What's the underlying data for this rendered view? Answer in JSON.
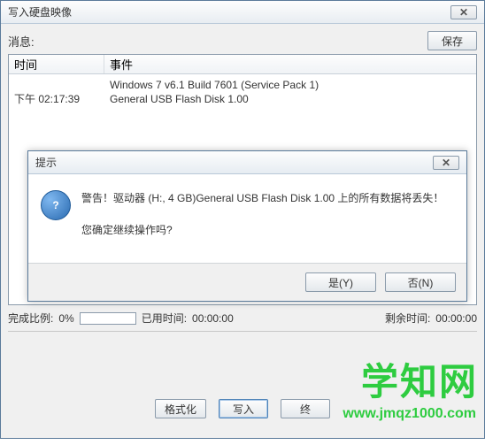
{
  "main": {
    "title": "写入硬盘映像",
    "close_glyph": "✕",
    "msg_label": "消息:",
    "save_label": "保存",
    "col_time": "时间",
    "col_event": "事件",
    "rows": [
      {
        "time": "",
        "event": "Windows 7 v6.1 Build 7601 (Service Pack 1)"
      },
      {
        "time": "下午 02:17:39",
        "event": "General USB Flash Disk  1.00"
      }
    ],
    "progress": {
      "done_label": "完成比例:",
      "done_value": "0%",
      "elapsed_label": "已用时间:",
      "elapsed_value": "00:00:00",
      "remain_label": "剩余时间:",
      "remain_value": "00:00:00"
    },
    "buttons": {
      "format": "格式化",
      "write": "写入",
      "abort": "终"
    }
  },
  "dialog": {
    "title": "提示",
    "close_glyph": "✕",
    "icon_glyph": "?",
    "warning": "警告！驱动器 (H:, 4 GB)General USB Flash Disk  1.00 上的所有数据将丢失！",
    "confirm": "您确定继续操作吗?",
    "yes": "是(Y)",
    "no": "否(N)"
  },
  "watermark": {
    "text": "学知网",
    "url": "www.jmqz1000.com"
  }
}
